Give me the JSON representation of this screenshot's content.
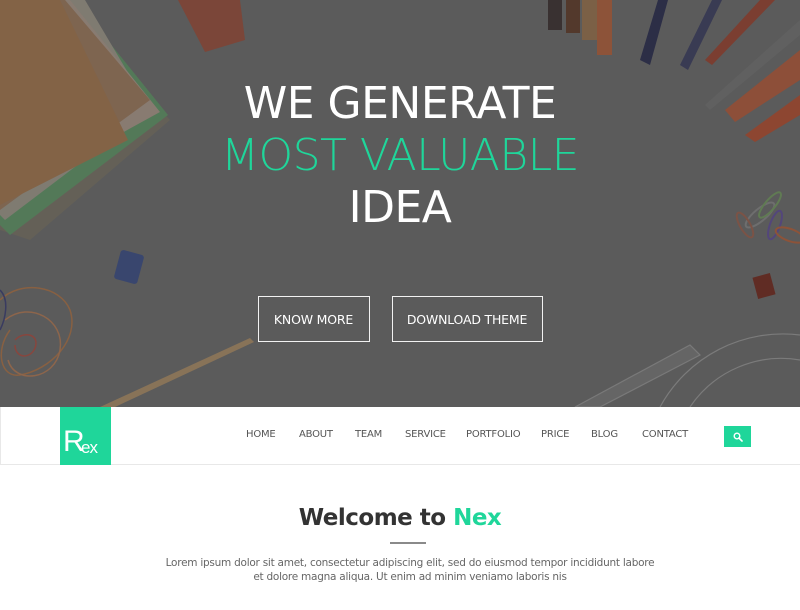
{
  "hero": {
    "title_line1": "WE GENERATE",
    "title_line2": "MOST VALUABLE",
    "title_line3": "IDEA",
    "buttons": [
      {
        "label": "KNOW MORE"
      },
      {
        "label": "DOWNLOAD THEME"
      }
    ]
  },
  "navbar": {
    "logo_big": "R",
    "logo_small": "ex",
    "items": [
      {
        "label": "HOME"
      },
      {
        "label": "ABOUT"
      },
      {
        "label": "TEAM"
      },
      {
        "label": "SERVICE"
      },
      {
        "label": "PORTFOLIO"
      },
      {
        "label": "PRICE"
      },
      {
        "label": "BLOG"
      },
      {
        "label": "CONTACT"
      }
    ],
    "search_icon": "search-icon"
  },
  "welcome": {
    "title_prefix": "Welcome to ",
    "title_accent": "Nex",
    "text": "Lorem ipsum dolor sit amet, consectetur adipiscing elit, sed do eiusmod tempor incididunt labore et dolore magna aliqua. Ut enim ad minim veniamo laboris nis"
  },
  "colors": {
    "accent": "#1fd69a",
    "hero_overlay": "#626262",
    "text_dark": "#333333",
    "text_muted": "#666666"
  }
}
